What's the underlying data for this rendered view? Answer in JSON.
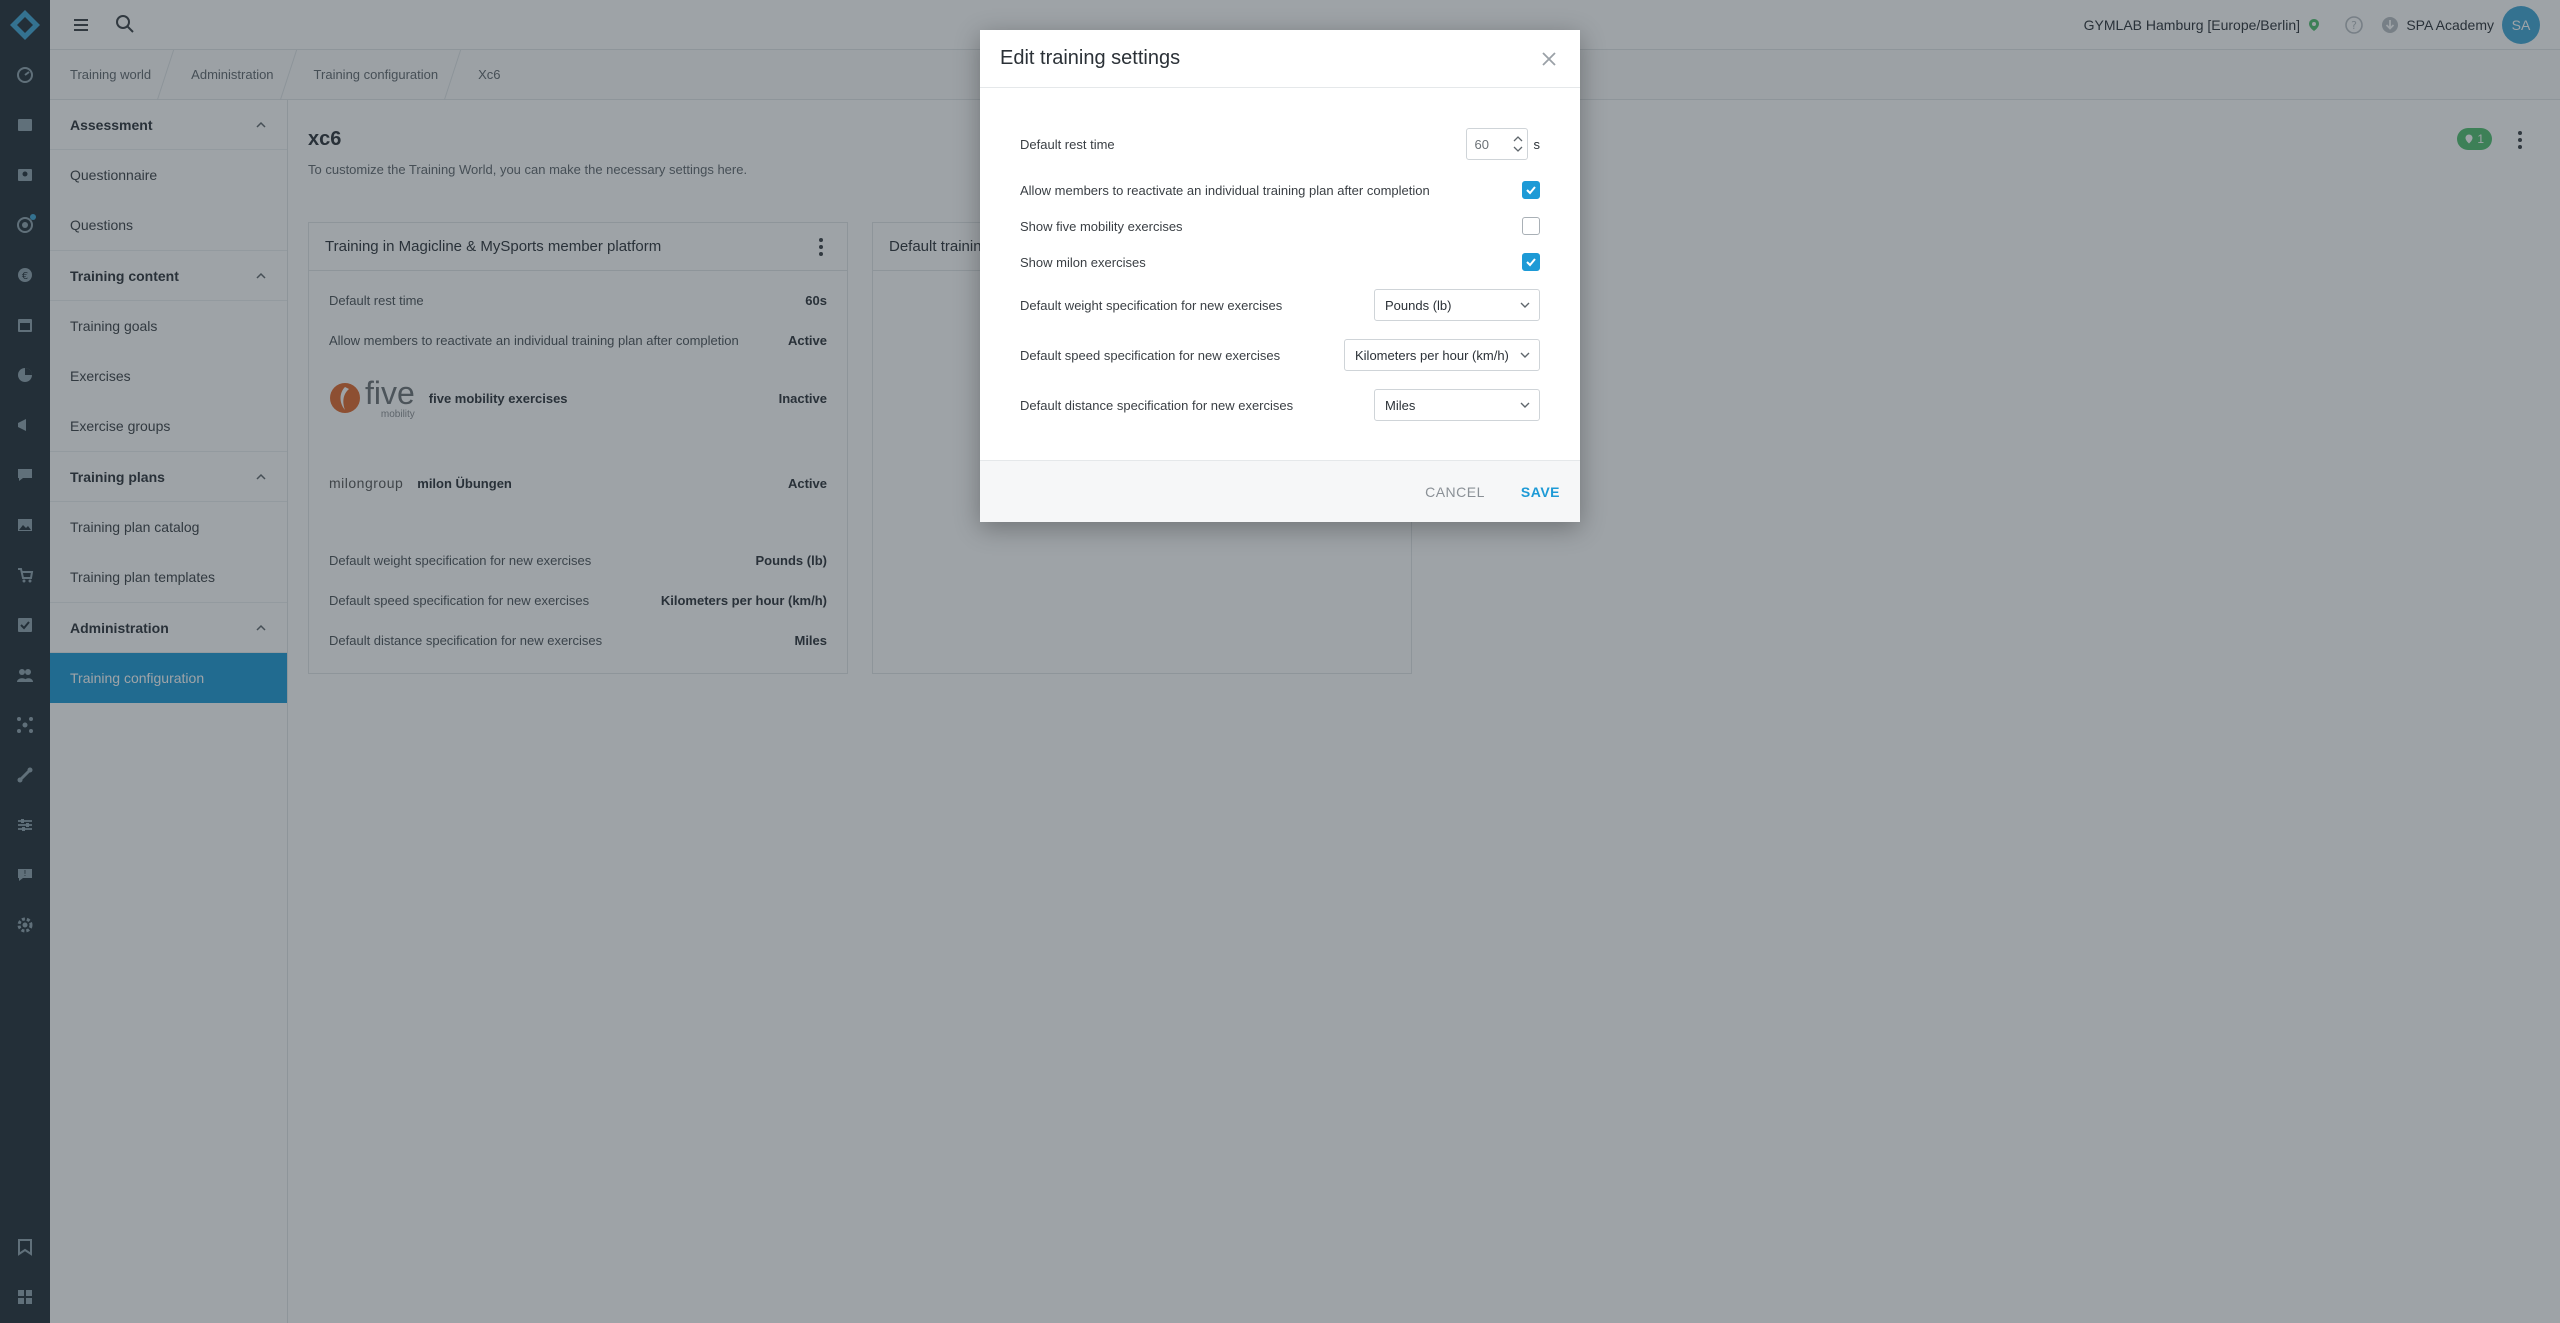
{
  "topbar": {
    "studio": "GYMLAB Hamburg [Europe/Berlin]",
    "user_name": "SPA Academy",
    "avatar_initials": "SA"
  },
  "breadcrumb": [
    "Training world",
    "Administration",
    "Training configuration",
    "Xc6"
  ],
  "sidenav": {
    "groups": [
      {
        "title": "Assessment",
        "items": [
          "Questionnaire",
          "Questions"
        ]
      },
      {
        "title": "Training content",
        "items": [
          "Training goals",
          "Exercises",
          "Exercise groups"
        ]
      },
      {
        "title": "Training plans",
        "items": [
          "Training plan catalog",
          "Training plan templates"
        ]
      },
      {
        "title": "Administration",
        "items": [
          "Training configuration"
        ]
      }
    ],
    "active_item": "Training configuration"
  },
  "main": {
    "title": "xc6",
    "subtitle": "To customize the Training World, you can make the necessary settings here.",
    "badge_count": "1",
    "card1": {
      "title": "Training in Magicline & MySports member platform",
      "rows": [
        {
          "label": "Default rest time",
          "value": "60s"
        },
        {
          "label": "Allow members to reactivate an individual training plan after completion",
          "value": "Active"
        },
        {
          "label": "five mobility exercises",
          "value": "Inactive"
        },
        {
          "label": "milon Übungen",
          "value": "Active"
        },
        {
          "label": "Default weight specification for new exercises",
          "value": "Pounds (lb)"
        },
        {
          "label": "Default speed specification for new exercises",
          "value": "Kilometers per hour (km/h)"
        },
        {
          "label": "Default distance specification for new exercises",
          "value": "Miles"
        }
      ],
      "five_logo_word": "five",
      "five_logo_sub": "mobility",
      "milon_logo_word": "milongroup"
    },
    "card2": {
      "title": "Default trainin"
    }
  },
  "modal": {
    "title": "Edit training settings",
    "rest_time": {
      "label": "Default rest time",
      "value": "60",
      "unit": "s"
    },
    "reactivate": {
      "label": "Allow members to reactivate an individual training plan after completion",
      "checked": true
    },
    "five": {
      "label": "Show five mobility exercises",
      "checked": false
    },
    "milon": {
      "label": "Show milon exercises",
      "checked": true
    },
    "weight": {
      "label": "Default weight specification for new exercises",
      "value": "Pounds (lb)"
    },
    "speed": {
      "label": "Default speed specification for new exercises",
      "value": "Kilometers per hour (km/h)"
    },
    "distance": {
      "label": "Default distance specification for new exercises",
      "value": "Miles"
    },
    "cancel_label": "CANCEL",
    "save_label": "SAVE"
  },
  "colors": {
    "accent": "#1d9ad6",
    "rail": "#1f2d35",
    "badge": "#4fbf6e",
    "five_orange": "#e0672a"
  }
}
